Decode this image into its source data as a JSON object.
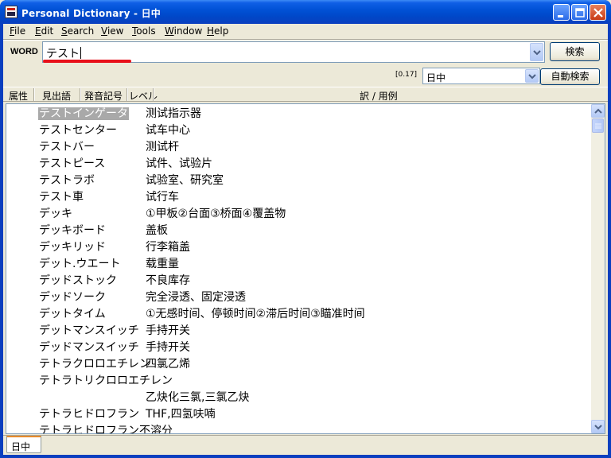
{
  "window": {
    "title": "Personal Dictionary - 日中",
    "controls": [
      "minimize",
      "maximize",
      "close"
    ]
  },
  "menubar": {
    "items": [
      "File",
      "Edit",
      "Search",
      "View",
      "Tools",
      "Window",
      "Help"
    ]
  },
  "search": {
    "label": "WORD",
    "value": "テスト",
    "button": "検索"
  },
  "toolbar2": {
    "version": "[0.17]",
    "language": "日中",
    "auto_search_button": "自動検索"
  },
  "columns": [
    "属性",
    "見出語",
    "発音記号",
    "レベル",
    "訳 / 用例"
  ],
  "entries": [
    {
      "word": "テストインゲータ",
      "translation": "测试指示器",
      "selected": true
    },
    {
      "word": "テストセンター",
      "translation": "试车中心"
    },
    {
      "word": "テストバー",
      "translation": "测试杆"
    },
    {
      "word": "テストピース",
      "translation": "试件、试验片"
    },
    {
      "word": "テストラボ",
      "translation": "试验室、研究室"
    },
    {
      "word": "テスト車",
      "translation": "试行车"
    },
    {
      "word": "デッキ",
      "translation": "①甲板②台面③桥面④覆盖物"
    },
    {
      "word": "デッキボード",
      "translation": "盖板"
    },
    {
      "word": "デッキリッド",
      "translation": "行李箱盖"
    },
    {
      "word": "デット.ウエート",
      "translation": "载重量"
    },
    {
      "word": "デッドストック",
      "translation": "不良库存"
    },
    {
      "word": "デッドソーク",
      "translation": "完全浸透、固定浸透"
    },
    {
      "word": "デットタイム",
      "translation": "①无感时间、停顿时间②滞后时间③瞄准时间"
    },
    {
      "word": "デットマンスイッチ",
      "translation": "手持开关"
    },
    {
      "word": "デッドマンスイッチ",
      "translation": "手持开关"
    },
    {
      "word": "テトラクロロエチレン",
      "translation": "四氯乙烯"
    },
    {
      "word": "テトラトリクロロエチレン",
      "translation": ""
    },
    {
      "word": "",
      "translation": "乙炔化三氯,三氯乙炔"
    },
    {
      "word": "テトラヒドロフラン",
      "translation": "THF,四氢呋喃"
    },
    {
      "word": "テトラヒドロフラン不溶分",
      "translation": ""
    }
  ],
  "tabs": [
    "日中"
  ]
}
